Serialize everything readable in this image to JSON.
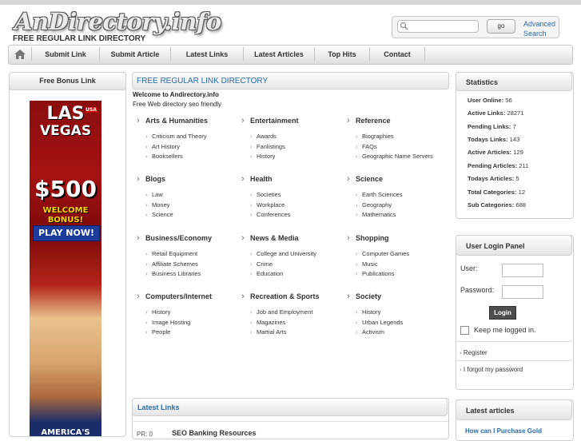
{
  "header": {
    "logo": "AnDirectory.info",
    "tagline": "FREE REGULAR LINK DIRECTORY"
  },
  "search": {
    "placeholder": "",
    "go_label": "go",
    "advanced_line1": "Advanced",
    "advanced_line2": "Search"
  },
  "nav": {
    "home_icon": "home-icon",
    "items": [
      "Submit Link",
      "Submit Article",
      "Latest Links",
      "Latest Articles",
      "Top Hits",
      "Contact"
    ]
  },
  "left_panel": {
    "title": "Free Bonus Link",
    "ad": {
      "line1": "LAS",
      "line2": "VEGAS",
      "badge": "USA",
      "amount": "$500",
      "welcome": "WELCOME",
      "bonus": "BONUS!",
      "cta": "PLAY NOW!",
      "bottom": "AMERICA'S"
    }
  },
  "main": {
    "title": "FREE REGULAR LINK DIRECTORY",
    "welcome": "Welcome to Andirectory.info",
    "subtitle": "Free Web directory seo friendly",
    "categories": [
      {
        "name": "Arts & Humanities",
        "links": [
          "Criticism and Theory",
          "Art History",
          "Booksellers"
        ]
      },
      {
        "name": "Entertainment",
        "links": [
          "Awards",
          "Fanlistings",
          "History"
        ]
      },
      {
        "name": "Reference",
        "links": [
          "Biographies",
          "FAQs",
          "Geographic Name Servers"
        ]
      },
      {
        "name": "Blogs",
        "links": [
          "Law",
          "Money",
          "Science"
        ]
      },
      {
        "name": "Health",
        "links": [
          "Societies",
          "Workplace",
          "Conferences"
        ]
      },
      {
        "name": "Science",
        "links": [
          "Earth Sciences",
          "Geography",
          "Mathematics"
        ]
      },
      {
        "name": "Business/Economy",
        "links": [
          "Retail Equipment",
          "Affiliate Schemes",
          "Business Libraries"
        ]
      },
      {
        "name": "News & Media",
        "links": [
          "College and University",
          "Crime",
          "Education"
        ]
      },
      {
        "name": "Shopping",
        "links": [
          "Computer Games",
          "Music",
          "Publications"
        ]
      },
      {
        "name": "Computers/Internet",
        "links": [
          "History",
          "Image Hosting",
          "People"
        ]
      },
      {
        "name": "Recreation & Sports",
        "links": [
          "Job and Employment",
          "Magazines",
          "Martial Arts"
        ]
      },
      {
        "name": "Society",
        "links": [
          "History",
          "Urban Legends",
          "Activism"
        ]
      }
    ],
    "latest_links_title": "Latest Links",
    "latest_links": [
      {
        "pr": "PR: 0",
        "title": "SEO Banking Resources"
      }
    ]
  },
  "statistics": {
    "title": "Statistics",
    "rows": [
      {
        "label": "User Online:",
        "value": "56"
      },
      {
        "label": "Active Links:",
        "value": "28271"
      },
      {
        "label": "Pending Links:",
        "value": "7"
      },
      {
        "label": "Todays Links:",
        "value": "143"
      },
      {
        "label": "Active Articles:",
        "value": "129"
      },
      {
        "label": "Pending Articles:",
        "value": "211"
      },
      {
        "label": "Todays Articles:",
        "value": "5"
      },
      {
        "label": "Total Categories:",
        "value": "12"
      },
      {
        "label": "Sub Categories:",
        "value": "688"
      }
    ]
  },
  "login": {
    "title": "User Login Panel",
    "user_label": "User:",
    "password_label": "Password:",
    "button": "Login",
    "remember": "Keep me logged in.",
    "register": "Register",
    "forgot": "I forgot my password"
  },
  "latest_articles": {
    "title": "Latest articles",
    "first": "How can I Purchase Gold"
  }
}
